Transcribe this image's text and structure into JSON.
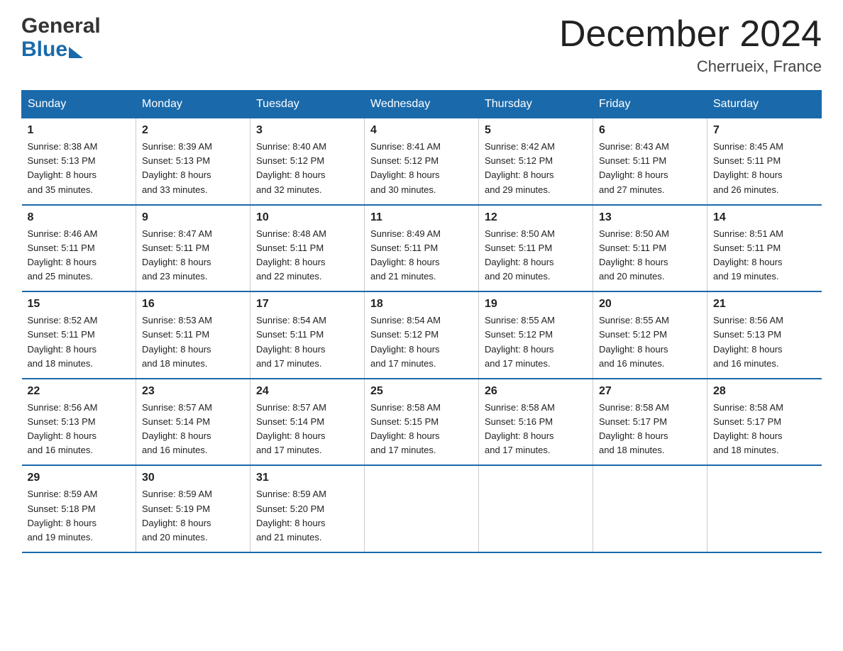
{
  "header": {
    "logo_general": "General",
    "logo_blue": "Blue",
    "month_title": "December 2024",
    "location": "Cherrueix, France"
  },
  "days_of_week": [
    "Sunday",
    "Monday",
    "Tuesday",
    "Wednesday",
    "Thursday",
    "Friday",
    "Saturday"
  ],
  "weeks": [
    [
      {
        "day": "1",
        "sunrise": "8:38 AM",
        "sunset": "5:13 PM",
        "daylight": "8 hours and 35 minutes."
      },
      {
        "day": "2",
        "sunrise": "8:39 AM",
        "sunset": "5:13 PM",
        "daylight": "8 hours and 33 minutes."
      },
      {
        "day": "3",
        "sunrise": "8:40 AM",
        "sunset": "5:12 PM",
        "daylight": "8 hours and 32 minutes."
      },
      {
        "day": "4",
        "sunrise": "8:41 AM",
        "sunset": "5:12 PM",
        "daylight": "8 hours and 30 minutes."
      },
      {
        "day": "5",
        "sunrise": "8:42 AM",
        "sunset": "5:12 PM",
        "daylight": "8 hours and 29 minutes."
      },
      {
        "day": "6",
        "sunrise": "8:43 AM",
        "sunset": "5:11 PM",
        "daylight": "8 hours and 27 minutes."
      },
      {
        "day": "7",
        "sunrise": "8:45 AM",
        "sunset": "5:11 PM",
        "daylight": "8 hours and 26 minutes."
      }
    ],
    [
      {
        "day": "8",
        "sunrise": "8:46 AM",
        "sunset": "5:11 PM",
        "daylight": "8 hours and 25 minutes."
      },
      {
        "day": "9",
        "sunrise": "8:47 AM",
        "sunset": "5:11 PM",
        "daylight": "8 hours and 23 minutes."
      },
      {
        "day": "10",
        "sunrise": "8:48 AM",
        "sunset": "5:11 PM",
        "daylight": "8 hours and 22 minutes."
      },
      {
        "day": "11",
        "sunrise": "8:49 AM",
        "sunset": "5:11 PM",
        "daylight": "8 hours and 21 minutes."
      },
      {
        "day": "12",
        "sunrise": "8:50 AM",
        "sunset": "5:11 PM",
        "daylight": "8 hours and 20 minutes."
      },
      {
        "day": "13",
        "sunrise": "8:50 AM",
        "sunset": "5:11 PM",
        "daylight": "8 hours and 20 minutes."
      },
      {
        "day": "14",
        "sunrise": "8:51 AM",
        "sunset": "5:11 PM",
        "daylight": "8 hours and 19 minutes."
      }
    ],
    [
      {
        "day": "15",
        "sunrise": "8:52 AM",
        "sunset": "5:11 PM",
        "daylight": "8 hours and 18 minutes."
      },
      {
        "day": "16",
        "sunrise": "8:53 AM",
        "sunset": "5:11 PM",
        "daylight": "8 hours and 18 minutes."
      },
      {
        "day": "17",
        "sunrise": "8:54 AM",
        "sunset": "5:11 PM",
        "daylight": "8 hours and 17 minutes."
      },
      {
        "day": "18",
        "sunrise": "8:54 AM",
        "sunset": "5:12 PM",
        "daylight": "8 hours and 17 minutes."
      },
      {
        "day": "19",
        "sunrise": "8:55 AM",
        "sunset": "5:12 PM",
        "daylight": "8 hours and 17 minutes."
      },
      {
        "day": "20",
        "sunrise": "8:55 AM",
        "sunset": "5:12 PM",
        "daylight": "8 hours and 16 minutes."
      },
      {
        "day": "21",
        "sunrise": "8:56 AM",
        "sunset": "5:13 PM",
        "daylight": "8 hours and 16 minutes."
      }
    ],
    [
      {
        "day": "22",
        "sunrise": "8:56 AM",
        "sunset": "5:13 PM",
        "daylight": "8 hours and 16 minutes."
      },
      {
        "day": "23",
        "sunrise": "8:57 AM",
        "sunset": "5:14 PM",
        "daylight": "8 hours and 16 minutes."
      },
      {
        "day": "24",
        "sunrise": "8:57 AM",
        "sunset": "5:14 PM",
        "daylight": "8 hours and 17 minutes."
      },
      {
        "day": "25",
        "sunrise": "8:58 AM",
        "sunset": "5:15 PM",
        "daylight": "8 hours and 17 minutes."
      },
      {
        "day": "26",
        "sunrise": "8:58 AM",
        "sunset": "5:16 PM",
        "daylight": "8 hours and 17 minutes."
      },
      {
        "day": "27",
        "sunrise": "8:58 AM",
        "sunset": "5:17 PM",
        "daylight": "8 hours and 18 minutes."
      },
      {
        "day": "28",
        "sunrise": "8:58 AM",
        "sunset": "5:17 PM",
        "daylight": "8 hours and 18 minutes."
      }
    ],
    [
      {
        "day": "29",
        "sunrise": "8:59 AM",
        "sunset": "5:18 PM",
        "daylight": "8 hours and 19 minutes."
      },
      {
        "day": "30",
        "sunrise": "8:59 AM",
        "sunset": "5:19 PM",
        "daylight": "8 hours and 20 minutes."
      },
      {
        "day": "31",
        "sunrise": "8:59 AM",
        "sunset": "5:20 PM",
        "daylight": "8 hours and 21 minutes."
      },
      null,
      null,
      null,
      null
    ]
  ],
  "labels": {
    "sunrise": "Sunrise:",
    "sunset": "Sunset:",
    "daylight": "Daylight:"
  }
}
